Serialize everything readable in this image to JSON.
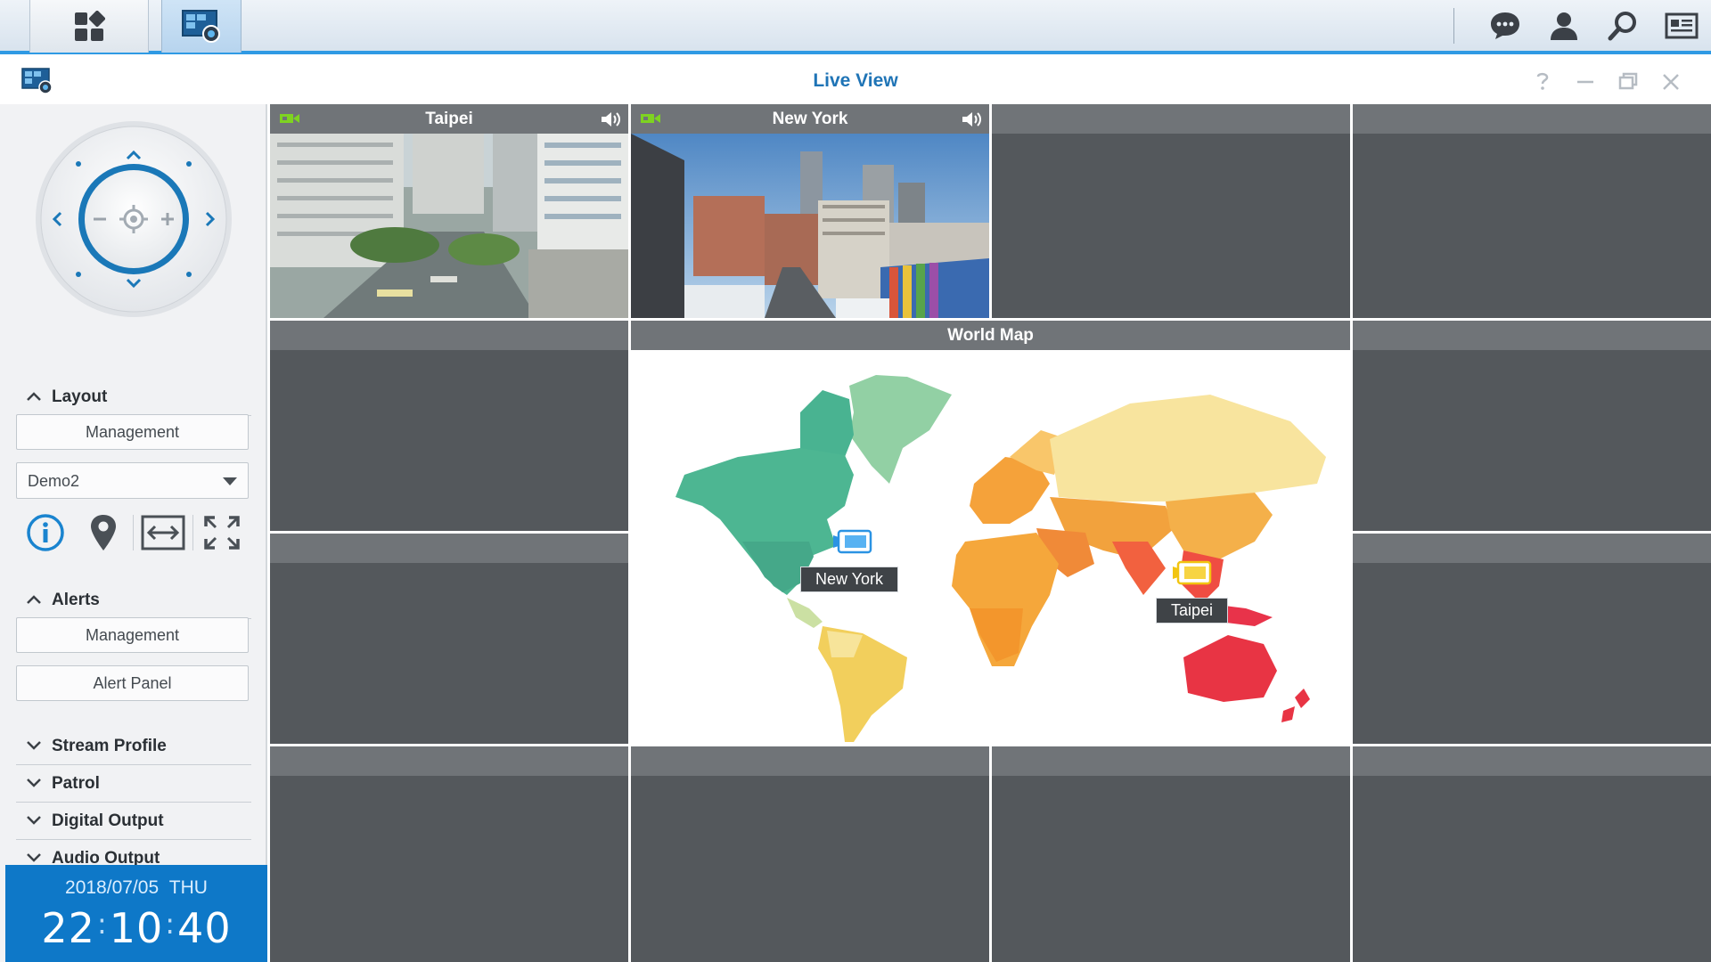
{
  "window": {
    "title": "Live View"
  },
  "taskbar": {
    "left_icons": [
      "main-menu-icon",
      "surveillance-station-icon"
    ],
    "right_icons": [
      "chat-icon",
      "user-icon",
      "search-icon",
      "widgets-icon"
    ]
  },
  "window_controls": [
    "help-icon",
    "minimize-icon",
    "restore-icon",
    "close-icon"
  ],
  "sidebar": {
    "layout": {
      "label": "Layout",
      "management_label": "Management",
      "selected_layout": "Demo2",
      "tools": [
        "info-icon",
        "location-pin-icon",
        "fit-width-icon",
        "fullscreen-icon"
      ]
    },
    "alerts": {
      "label": "Alerts",
      "management_label": "Management",
      "panel_label": "Alert Panel"
    },
    "collapsed_sections": [
      "Stream Profile",
      "Patrol",
      "Digital Output",
      "Audio Output"
    ],
    "clock": {
      "date": "2018/07/05",
      "weekday": "THU",
      "hh": "22",
      "mm": "10",
      "ss": "40"
    }
  },
  "cameras": [
    {
      "name": "Taipei",
      "selected": true
    },
    {
      "name": "New York",
      "selected": false
    }
  ],
  "map": {
    "title": "World Map",
    "markers": [
      {
        "label": "New York"
      },
      {
        "label": "Taipei"
      }
    ]
  },
  "colors": {
    "accent": "#1f74b6",
    "clock_bg": "#0e78c8",
    "selection": "#f2c511",
    "cell_bg": "#54585c",
    "cell_header": "#707478"
  }
}
